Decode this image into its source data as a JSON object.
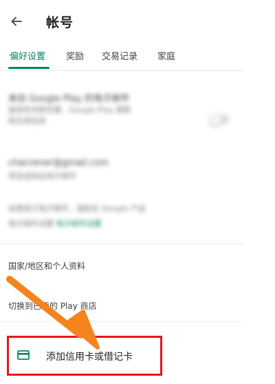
{
  "header": {
    "title": "帐号",
    "back_icon": "arrow-left-icon"
  },
  "tabs": [
    {
      "label": "偏好设置",
      "active": true
    },
    {
      "label": "奖励",
      "active": false
    },
    {
      "label": "交易记录",
      "active": false
    },
    {
      "label": "家庭",
      "active": false
    }
  ],
  "blurred_section": {
    "email_updates_title": "来自 Google Play 的电子邮件",
    "email_updates_desc_1": "接收有关新优惠、Google Play 更新",
    "email_updates_desc_2": "和实用信息",
    "email_address": "chacrener@gmail.com",
    "email_address_desc": "将发送到此电子邮件",
    "footer_desc_1": "如需退订电子邮件，请前往 Google 产品",
    "footer_desc_2": "电子邮件设置",
    "footer_link": "电子邮件设置"
  },
  "rows": {
    "country_profile": "国家/地区和个人资料",
    "switch_store": "切换到巴西的 Play 商店",
    "add_card": "添加信用卡或借记卡"
  },
  "colors": {
    "accent_green": "#01875f",
    "highlight_red": "#e8151b",
    "arrow_orange": "#f5841f"
  },
  "icons": {
    "card": "credit-card-icon",
    "annotation_arrow": "annotation-arrow-icon"
  }
}
